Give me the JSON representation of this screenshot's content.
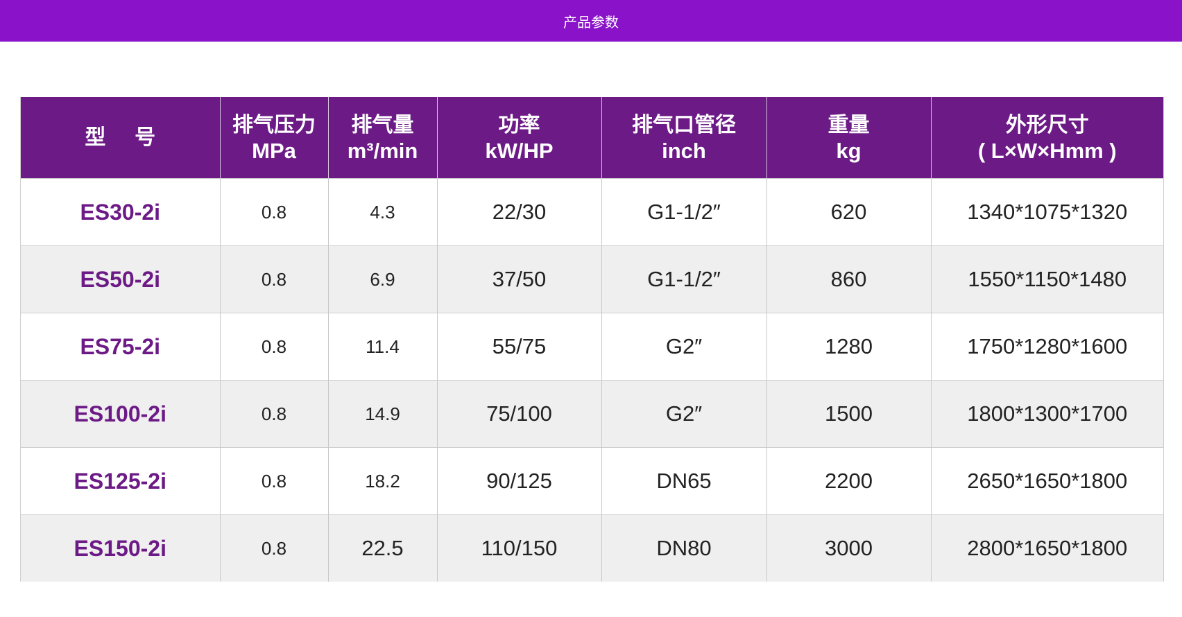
{
  "banner": {
    "title": "产品参数"
  },
  "table": {
    "headers": [
      {
        "cn": "型    号",
        "unit": ""
      },
      {
        "cn": "排气压力",
        "unit": "MPa"
      },
      {
        "cn": "排气量",
        "unit": "m³/min"
      },
      {
        "cn": "功率",
        "unit": "kW/HP"
      },
      {
        "cn": "排气口管径",
        "unit": "inch"
      },
      {
        "cn": "重量",
        "unit": "kg"
      },
      {
        "cn": "外形尺寸",
        "unit": "( L×W×Hmm )"
      }
    ],
    "rows": [
      [
        "ES30-2i",
        "0.8",
        "4.3",
        "22/30",
        "G1-1/2″",
        "620",
        "1340*1075*1320"
      ],
      [
        "ES50-2i",
        "0.8",
        "6.9",
        "37/50",
        "G1-1/2″",
        "860",
        "1550*1150*1480"
      ],
      [
        "ES75-2i",
        "0.8",
        "11.4",
        "55/75",
        "G2″",
        "1280",
        "1750*1280*1600"
      ],
      [
        "ES100-2i",
        "0.8",
        "14.9",
        "75/100",
        "G2″",
        "1500",
        "1800*1300*1700"
      ],
      [
        "ES125-2i",
        "0.8",
        "18.2",
        "90/125",
        "DN65",
        "2200",
        "2650*1650*1800"
      ],
      [
        "ES150-2i",
        "0.8",
        "22.5",
        "110/150",
        "DN80",
        "3000",
        "2800*1650*1800"
      ]
    ]
  },
  "colors": {
    "banner": "#8a12c9",
    "header": "#6c1a86",
    "model_text": "#6c1a86",
    "row_alt": "#efefef"
  }
}
